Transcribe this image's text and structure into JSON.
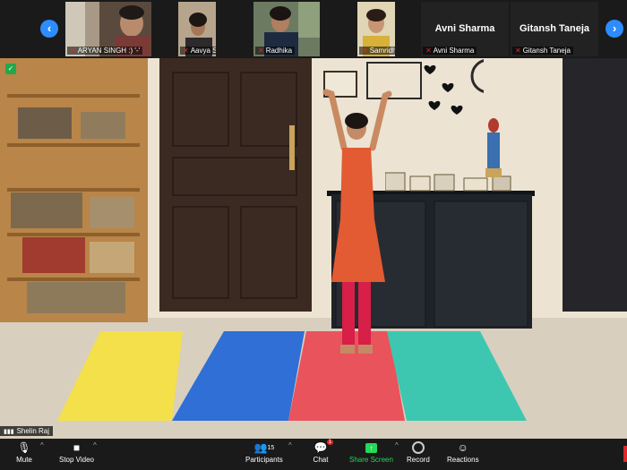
{
  "gallery": {
    "participants": [
      {
        "name": "ARYAN SINGH :) '-'",
        "muted": true,
        "video": true
      },
      {
        "name": "Aavya Sarna",
        "muted": true,
        "video": true
      },
      {
        "name": "Radhika",
        "muted": true,
        "video": true
      },
      {
        "name": "Samridhi",
        "muted": true,
        "video": true
      },
      {
        "name": "Avni Sharma",
        "muted": true,
        "video": false,
        "display": "Avni Sharma"
      },
      {
        "name": "Gitansh Taneja",
        "muted": true,
        "video": false,
        "display": "Gitansh Taneja"
      }
    ],
    "prev_icon": "chevron-left-icon",
    "next_icon": "chevron-right-icon"
  },
  "main": {
    "active_speaker": "Shelin Raj",
    "security_icon": "shield-icon"
  },
  "toolbar": {
    "mute": "Mute",
    "stop_video": "Stop Video",
    "participants": "Participants",
    "participants_count": "15",
    "chat": "Chat",
    "chat_badge": "1",
    "share_screen": "Share Screen",
    "record": "Record",
    "reactions": "Reactions"
  },
  "colors": {
    "accent": "#2d8cff",
    "share_green": "#23d959",
    "muted_red": "#e02828",
    "mat_yellow": "#f3e04a",
    "mat_blue": "#2f6fd6",
    "mat_red": "#e9535c",
    "mat_teal": "#3ec7b0"
  }
}
